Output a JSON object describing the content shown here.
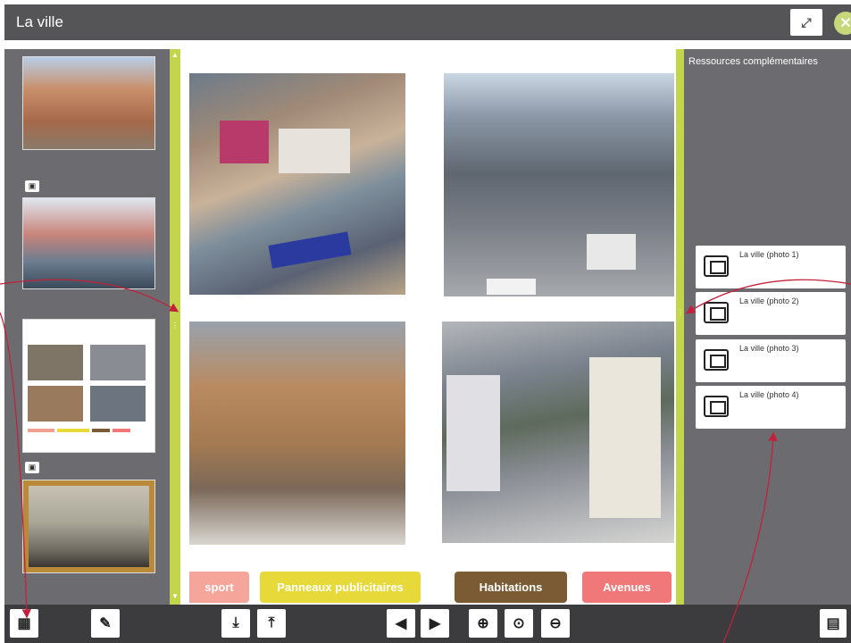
{
  "window": {
    "title": "La ville"
  },
  "header": {
    "fullscreen_icon": "fullscreen-icon",
    "close_icon": "close-icon"
  },
  "right_panel": {
    "title": "Ressources complémentaires",
    "items": [
      {
        "label": "La ville (photo 1)"
      },
      {
        "label": "La ville (photo 2)"
      },
      {
        "label": "La ville (photo 3)"
      },
      {
        "label": "La ville (photo 4)"
      }
    ]
  },
  "categories": [
    {
      "label": "sport",
      "color": "#f5a59a"
    },
    {
      "label": "Panneaux publicitaires",
      "color": "#e8d93b"
    },
    {
      "label": "Habitations",
      "color": "#7a5b34"
    },
    {
      "label": "Avenues",
      "color": "#f07878"
    }
  ],
  "colors": {
    "accent": "#c3d64b",
    "panel": "#6c6c70",
    "annotation_arrow": "#c0223b"
  }
}
